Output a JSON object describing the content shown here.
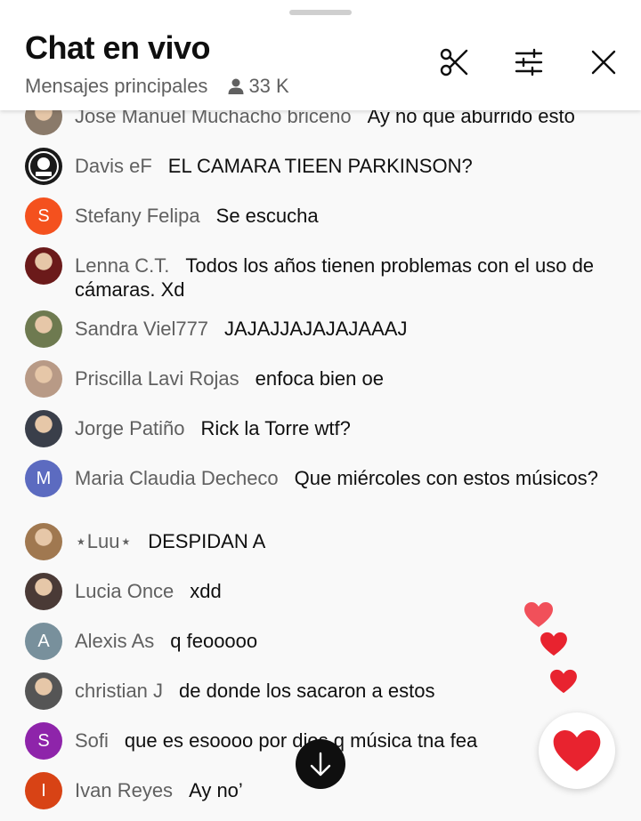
{
  "header": {
    "title": "Chat en vivo",
    "filter_label": "Mensajes principales",
    "viewer_count": "33 K",
    "icons": [
      "clip-icon",
      "tune-icon",
      "close-icon"
    ]
  },
  "messages": [
    {
      "author": "Jose Manuel Muchacho briceno",
      "text": "Ay no que aburrido esto",
      "avatar": {
        "type": "photo",
        "color": "#8a7a6a"
      }
    },
    {
      "author": "Davis eF",
      "text": "EL CAMARA TIEEN PARKINSON?",
      "avatar": {
        "type": "logo",
        "color": "#1a1a1a"
      }
    },
    {
      "author": "Stefany Felipa",
      "text": "Se escucha",
      "avatar": {
        "type": "letter",
        "letter": "S",
        "color": "#f4511e"
      }
    },
    {
      "author": "Lenna C.T.",
      "text": "Todos los años tienen problemas con el uso de cámaras. Xd",
      "avatar": {
        "type": "photo",
        "color": "#6b1a1a"
      }
    },
    {
      "author": "Sandra Viel777",
      "text": "JAJAJJAJAJAJAAAJ",
      "avatar": {
        "type": "photo",
        "color": "#6e7a50"
      }
    },
    {
      "author": "Priscilla Lavi Rojas",
      "text": "enfoca bien oe",
      "avatar": {
        "type": "photo",
        "color": "#b89a86"
      }
    },
    {
      "author": "Jorge Patiño",
      "text": "Rick la Torre wtf?",
      "avatar": {
        "type": "photo",
        "color": "#3a3f4a"
      }
    },
    {
      "author": "Maria Claudia Decheco",
      "text": "Que miércoles con estos músicos?",
      "avatar": {
        "type": "letter",
        "letter": "M",
        "color": "#5c6bc0"
      }
    },
    {
      "author": "⋆Luu⋆",
      "text": "DESPIDAN A",
      "avatar": {
        "type": "photo",
        "color": "#a07850"
      }
    },
    {
      "author": "Lucia Once",
      "text": "xdd",
      "avatar": {
        "type": "photo",
        "color": "#4a3a36"
      }
    },
    {
      "author": "Alexis As",
      "text": "q feooooo",
      "avatar": {
        "type": "letter",
        "letter": "A",
        "color": "#78909c"
      }
    },
    {
      "author": "christian J",
      "text": "de donde los sacaron a estos",
      "avatar": {
        "type": "photo",
        "color": "#555555"
      }
    },
    {
      "author": "Sofi",
      "text": "que es esoooo por dios q música tna fea",
      "avatar": {
        "type": "letter",
        "letter": "S",
        "color": "#8e24aa"
      }
    },
    {
      "author": "Ivan Reyes",
      "text": "Ay no’",
      "avatar": {
        "type": "letter",
        "letter": "I",
        "color": "#d84315"
      }
    }
  ],
  "colors": {
    "heart": "#e8232f",
    "author": "#606060",
    "text": "#0f0f0f"
  },
  "controls": {
    "scroll_down_icon": "arrow-down-icon",
    "reaction_icon": "heart-icon"
  }
}
